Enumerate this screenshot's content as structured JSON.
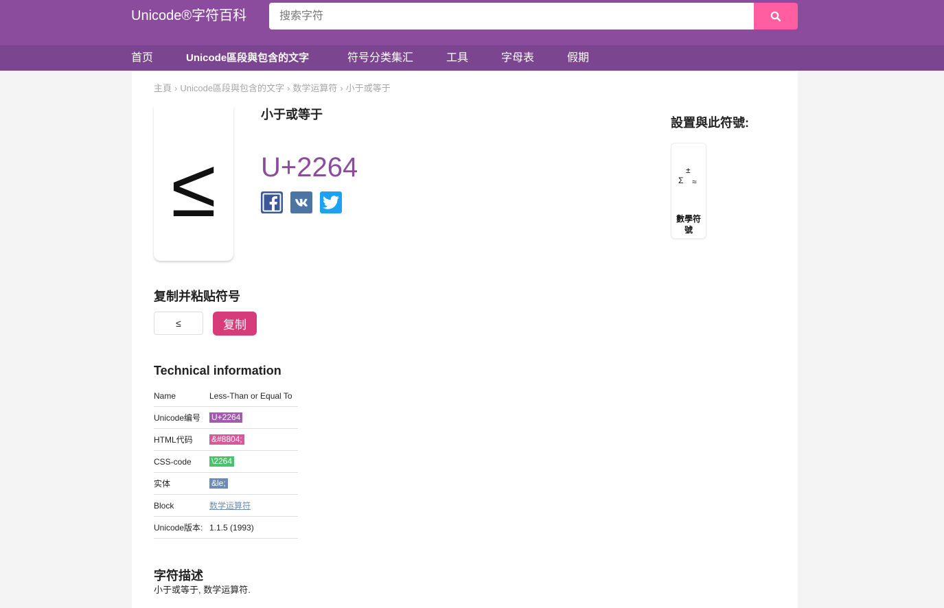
{
  "header": {
    "logo": "Unicode®字符百科",
    "search_placeholder": "搜索字符",
    "search_icon": "search-icon"
  },
  "nav": {
    "items": [
      {
        "label": "首页"
      },
      {
        "label": "Unicode區段與包含的文字",
        "active": true
      },
      {
        "label": "符号分类集汇"
      },
      {
        "label": "工具"
      },
      {
        "label": "字母表"
      },
      {
        "label": "假期"
      }
    ]
  },
  "breadcrumb": {
    "separator": "›",
    "items": [
      "主頁",
      "Unicode區段與包含的文字",
      "数学运算符",
      "小于或等于"
    ]
  },
  "symbol": {
    "glyph": "≤",
    "name": "小于或等于",
    "code": "U+2264"
  },
  "share": [
    {
      "icon": "facebook-icon",
      "color": "#3b5998"
    },
    {
      "icon": "vk-icon",
      "color": "#4c75a3"
    },
    {
      "icon": "twitter-icon",
      "color": "#1da1f2"
    }
  ],
  "related": {
    "heading": "設置與此符號:",
    "items": [
      {
        "icon": "math-symbols-icon",
        "glyphs": [
          "±",
          "Σ",
          "≈"
        ],
        "label": "數學符號"
      }
    ]
  },
  "copy": {
    "heading": "复制并粘贴符号",
    "value": "≤",
    "button": "复制"
  },
  "tech": {
    "heading": "Technical information",
    "rows": [
      {
        "label": "Name",
        "value": "Less-Than or Equal To"
      },
      {
        "label": "Unicode编号",
        "value": "U+2264",
        "badge_color": "#a25bae"
      },
      {
        "label": "HTML代码",
        "value": "&#8804;",
        "badge_color": "#d9589a"
      },
      {
        "label": "CSS-code",
        "value": "\\2264",
        "badge_color": "#46c36b"
      },
      {
        "label": "实体",
        "value": "&le;",
        "badge_color": "#6d8cb5"
      },
      {
        "label": "Block",
        "value": "数学运算符",
        "link": true
      },
      {
        "label": "Unicode版本:",
        "value": "1.1.5 (1993)"
      }
    ]
  },
  "description": {
    "heading": "字符描述",
    "text": "小于或等于, 数学运算符."
  },
  "colors": {
    "header_bg": "#8b4c9d",
    "nav_bg": "#7c4590",
    "accent": "#8b4c9d",
    "search_button": "#ff5ea0",
    "copy_button": "#d63c7a",
    "link": "#6d8cb5"
  }
}
